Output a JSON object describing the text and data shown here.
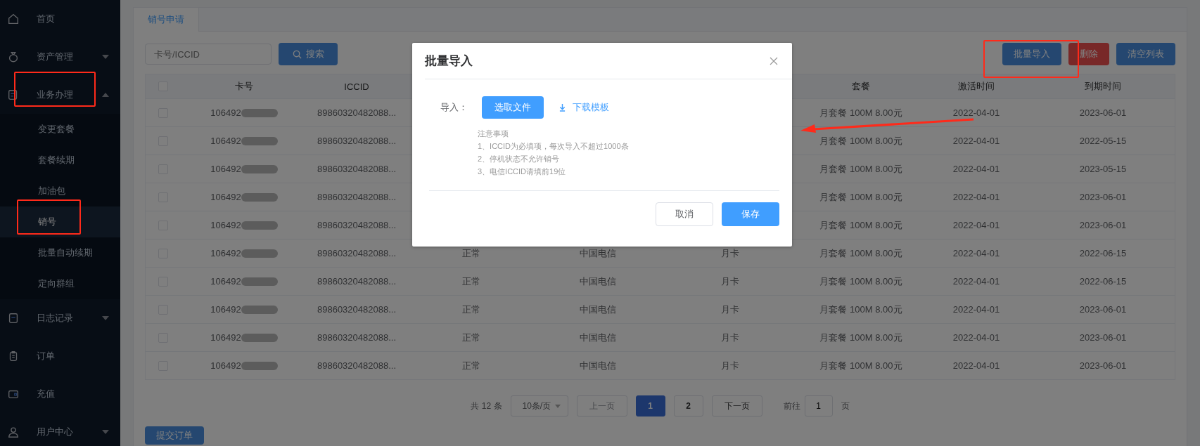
{
  "sidebar": {
    "items": [
      {
        "label": "首页"
      },
      {
        "label": "资产管理",
        "expanded": false
      },
      {
        "label": "业务办理",
        "expanded": true,
        "children": [
          {
            "label": "变更套餐",
            "selected": false
          },
          {
            "label": "套餐续期",
            "selected": false
          },
          {
            "label": "加油包",
            "selected": false
          },
          {
            "label": "销号",
            "selected": true
          },
          {
            "label": "批量自动续期",
            "selected": false
          },
          {
            "label": "定向群组",
            "selected": false
          }
        ]
      },
      {
        "label": "日志记录",
        "expanded": false
      },
      {
        "label": "订单"
      },
      {
        "label": "充值"
      },
      {
        "label": "用户中心",
        "expanded": false
      }
    ]
  },
  "tabs": [
    {
      "label": "销号申请",
      "selected": true
    }
  ],
  "search": {
    "placeholder": "卡号/ICCID",
    "button": "搜索"
  },
  "actions": [
    {
      "label": "批量导入",
      "kind": "primary"
    },
    {
      "label": "删除",
      "kind": "danger"
    },
    {
      "label": "清空列表",
      "kind": "primary"
    }
  ],
  "table": {
    "header_checked": false,
    "columns": [
      {
        "label": "卡号"
      },
      {
        "label": "ICCID"
      },
      {},
      {},
      {},
      {
        "label": "套餐"
      },
      {
        "label": "激活时间"
      },
      {
        "label": "到期时间"
      }
    ],
    "rows": [
      {
        "checked": false,
        "card": "106492",
        "iccid": "89860320482088...",
        "plan": "月套餐 100M 8.00元",
        "activated": "2022-04-01",
        "expires": "2023-06-01"
      },
      {
        "checked": false,
        "card": "106492",
        "iccid": "89860320482088...",
        "plan": "月套餐 100M 8.00元",
        "activated": "2022-04-01",
        "expires": "2022-05-15"
      },
      {
        "checked": false,
        "card": "106492",
        "iccid": "89860320482088...",
        "plan": "月套餐 100M 8.00元",
        "activated": "2022-04-01",
        "expires": "2023-05-15"
      },
      {
        "checked": false,
        "card": "106492",
        "iccid": "89860320482088...",
        "plan": "月套餐 100M 8.00元",
        "activated": "2022-04-01",
        "expires": "2023-06-01"
      },
      {
        "checked": false,
        "card": "106492",
        "iccid": "89860320482088...",
        "plan": "月套餐 100M 8.00元",
        "activated": "2022-04-01",
        "expires": "2023-06-01"
      },
      {
        "checked": false,
        "card": "106492",
        "iccid": "89860320482088...",
        "status": "正常",
        "carrier": "中国电信",
        "card_type": "月卡",
        "plan": "月套餐 100M 8.00元",
        "activated": "2022-04-01",
        "expires": "2022-06-15"
      },
      {
        "checked": false,
        "card": "106492",
        "iccid": "89860320482088...",
        "status": "正常",
        "carrier": "中国电信",
        "card_type": "月卡",
        "plan": "月套餐 100M 8.00元",
        "activated": "2022-04-01",
        "expires": "2022-06-15"
      },
      {
        "checked": false,
        "card": "106492",
        "iccid": "89860320482088...",
        "status": "正常",
        "carrier": "中国电信",
        "card_type": "月卡",
        "plan": "月套餐 100M 8.00元",
        "activated": "2022-04-01",
        "expires": "2023-06-01"
      },
      {
        "checked": false,
        "card": "106492",
        "iccid": "89860320482088...",
        "status": "正常",
        "carrier": "中国电信",
        "card_type": "月卡",
        "plan": "月套餐 100M 8.00元",
        "activated": "2022-04-01",
        "expires": "2023-06-01"
      },
      {
        "checked": false,
        "card": "106492",
        "iccid": "89860320482088...",
        "status": "正常",
        "carrier": "中国电信",
        "card_type": "月卡",
        "plan": "月套餐 100M 8.00元",
        "activated": "2022-04-01",
        "expires": "2023-06-01"
      }
    ]
  },
  "pagination": {
    "total": "共 12 条",
    "page_size": "10条/页",
    "prev": {
      "label": "上一页",
      "disabled": true
    },
    "pages": [
      {
        "label": "1",
        "selected": true
      },
      {
        "label": "2",
        "selected": false
      }
    ],
    "next": {
      "label": "下一页",
      "disabled": false
    },
    "goto_label": "前往",
    "goto_value": "1",
    "goto_suffix": "页"
  },
  "submit_button": "提交订单",
  "dialog": {
    "title": "批量导入",
    "import_label": "导入：",
    "choose_button": "选取文件",
    "download_link": "下载模板",
    "notes_title": "注意事项",
    "notes": [
      "1、ICCID为必填项，每次导入不超过1000条",
      "2、停机状态不允许销号",
      "3、电信ICCID请填前19位"
    ],
    "cancel": "取消",
    "save": "保存"
  }
}
